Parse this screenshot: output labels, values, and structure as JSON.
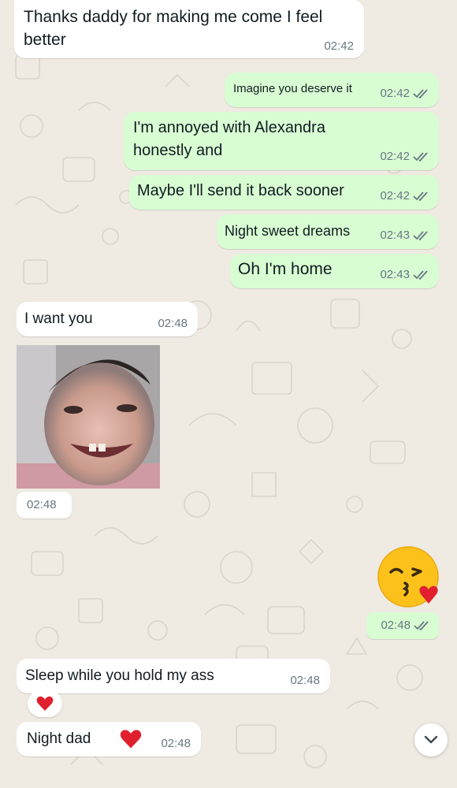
{
  "messages": [
    {
      "id": "m1",
      "dir": "in",
      "text_lines": [
        "Thanks daddy for making me come I feel",
        "better"
      ],
      "time": "02:42"
    },
    {
      "id": "m2",
      "dir": "out",
      "text": "Imagine you deserve it",
      "time": "02:42",
      "status": "read"
    },
    {
      "id": "m3",
      "dir": "out",
      "text_lines": [
        "I'm annoyed with Alexandra",
        "honestly and"
      ],
      "time": "02:42",
      "status": "read"
    },
    {
      "id": "m4",
      "dir": "out",
      "text": "Maybe I'll send it back sooner",
      "time": "02:42",
      "status": "read"
    },
    {
      "id": "m5",
      "dir": "out",
      "text": "Night sweet dreams",
      "time": "02:43",
      "status": "read"
    },
    {
      "id": "m6",
      "dir": "out",
      "text": "Oh I'm home",
      "time": "02:43",
      "status": "read"
    },
    {
      "id": "m7",
      "dir": "in",
      "text": "I want you",
      "time": "02:48"
    },
    {
      "id": "m8",
      "dir": "in",
      "type": "photo",
      "time": "02:48"
    },
    {
      "id": "m9",
      "dir": "out",
      "type": "emoji",
      "emoji": "face-blowing-a-kiss",
      "time": "02:48",
      "status": "read"
    },
    {
      "id": "m10",
      "dir": "in",
      "text": "Sleep while you hold my ass",
      "time": "02:48",
      "reaction": "red-heart"
    },
    {
      "id": "m11",
      "dir": "in",
      "text": "Night dad",
      "emoji": "red-heart",
      "time": "02:48"
    }
  ],
  "colors": {
    "wallpaper": "#efeae2",
    "incoming_bubble": "#ffffff",
    "outgoing_bubble": "#d9fdd3",
    "timestamp": "#667781",
    "read_tick": "#667781",
    "heart": "#e0202e"
  },
  "icons": {
    "read_status": "double-check-icon",
    "scroll_button": "chevron-down-icon"
  }
}
